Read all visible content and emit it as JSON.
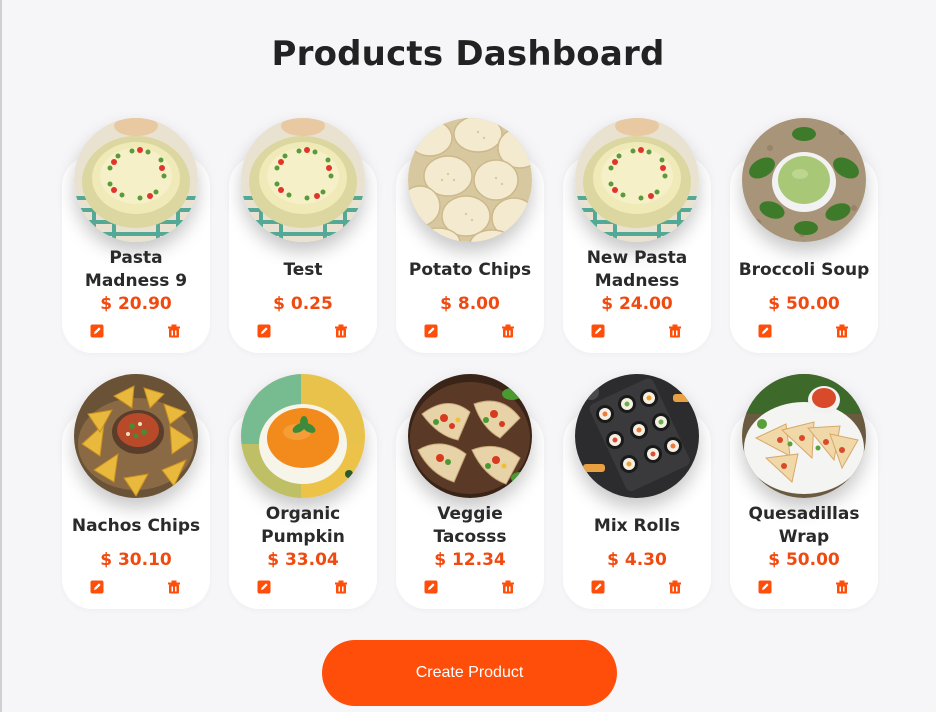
{
  "page": {
    "title": "Products Dashboard"
  },
  "colors": {
    "accent": "#ff4d0a",
    "price": "#f04a10",
    "background": "#f6f6f9"
  },
  "products": [
    {
      "name": "Pasta Madness 9",
      "price": "$ 20.90",
      "image": "creamy-pasta-bowl"
    },
    {
      "name": "Test",
      "price": "$ 0.25",
      "image": "creamy-pasta-bowl"
    },
    {
      "name": "Potato Chips",
      "price": "$ 8.00",
      "image": "potato-chips"
    },
    {
      "name": "New Pasta Madness",
      "price": "$ 24.00",
      "image": "creamy-pasta-bowl"
    },
    {
      "name": "Broccoli Soup",
      "price": "$ 50.00",
      "image": "broccoli-soup"
    },
    {
      "name": "Nachos Chips",
      "price": "$ 30.10",
      "image": "nachos-salsa"
    },
    {
      "name": "Organic Pumpkin",
      "price": "$ 33.04",
      "image": "pumpkin-soup"
    },
    {
      "name": "Veggie Tacosss",
      "price": "$ 12.34",
      "image": "tacos-platter"
    },
    {
      "name": "Mix Rolls",
      "price": "$ 4.30",
      "image": "sushi-rolls"
    },
    {
      "name": "Quesadillas Wrap",
      "price": "$ 50.00",
      "image": "quesadillas-plate"
    }
  ],
  "icons": {
    "edit": "edit-icon",
    "delete": "trash-icon"
  },
  "actions": {
    "create_label": "Create Product"
  }
}
